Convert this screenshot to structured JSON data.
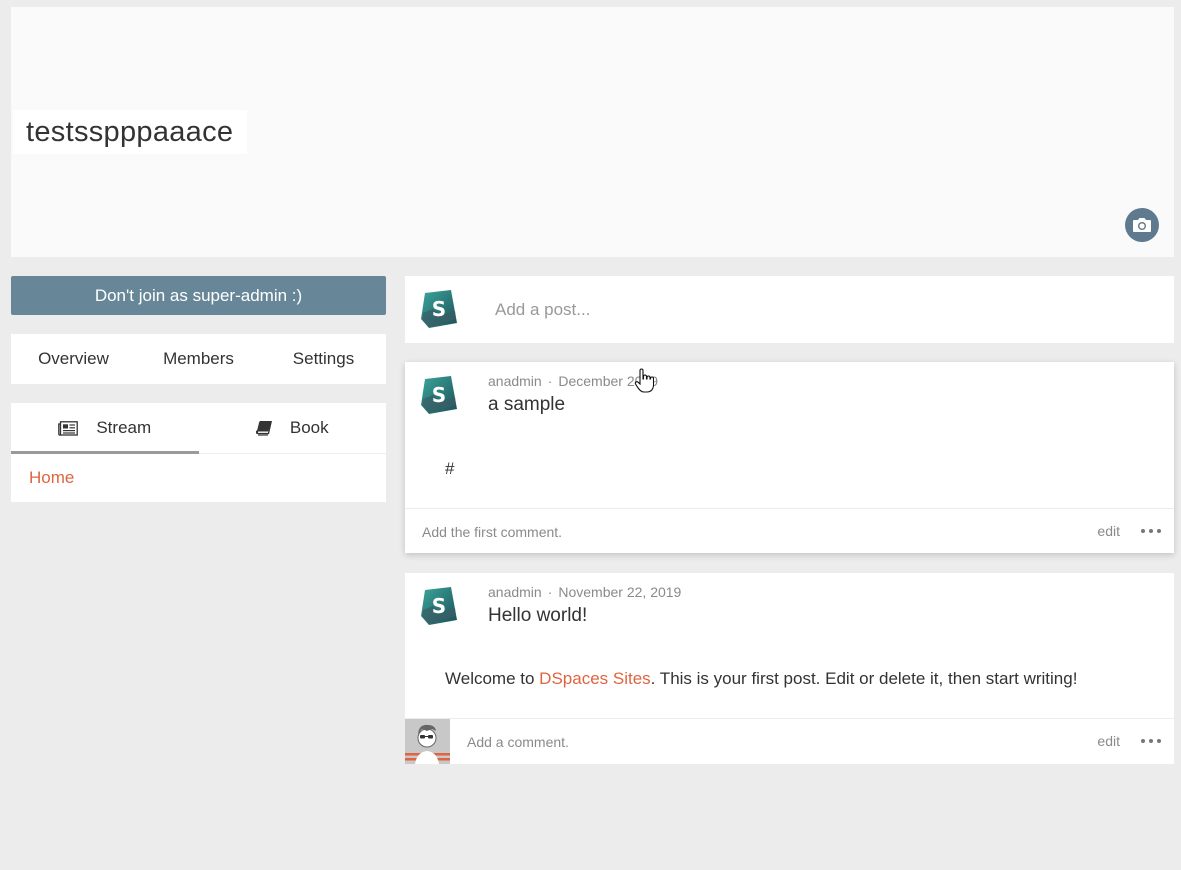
{
  "space": {
    "title": "testsspppaaace"
  },
  "sidebar": {
    "join_button": "Don't join as super-admin :)",
    "nav": [
      "Overview",
      "Members",
      "Settings"
    ],
    "tabs": [
      {
        "label": "Stream",
        "icon": "newspaper-icon",
        "active": true
      },
      {
        "label": "Book",
        "icon": "book-icon",
        "active": false
      }
    ],
    "home_link": "Home"
  },
  "composer": {
    "placeholder": "Add a post..."
  },
  "posts": [
    {
      "author": "anadmin",
      "date": "December 2019",
      "title": "a sample",
      "body": "#",
      "comment_placeholder": "Add the first comment.",
      "edit": "edit"
    },
    {
      "author": "anadmin",
      "date": "November 22, 2019",
      "title": "Hello world!",
      "body_before": "Welcome to ",
      "body_link": "DSpaces Sites",
      "body_after": ". This is your first post. Edit or delete it, then start writing!",
      "comment_placeholder": "Add a comment.",
      "edit": "edit"
    }
  ],
  "colors": {
    "accent": "#e0643f",
    "join_button": "#678798",
    "camera_button": "#5f7a8e"
  }
}
